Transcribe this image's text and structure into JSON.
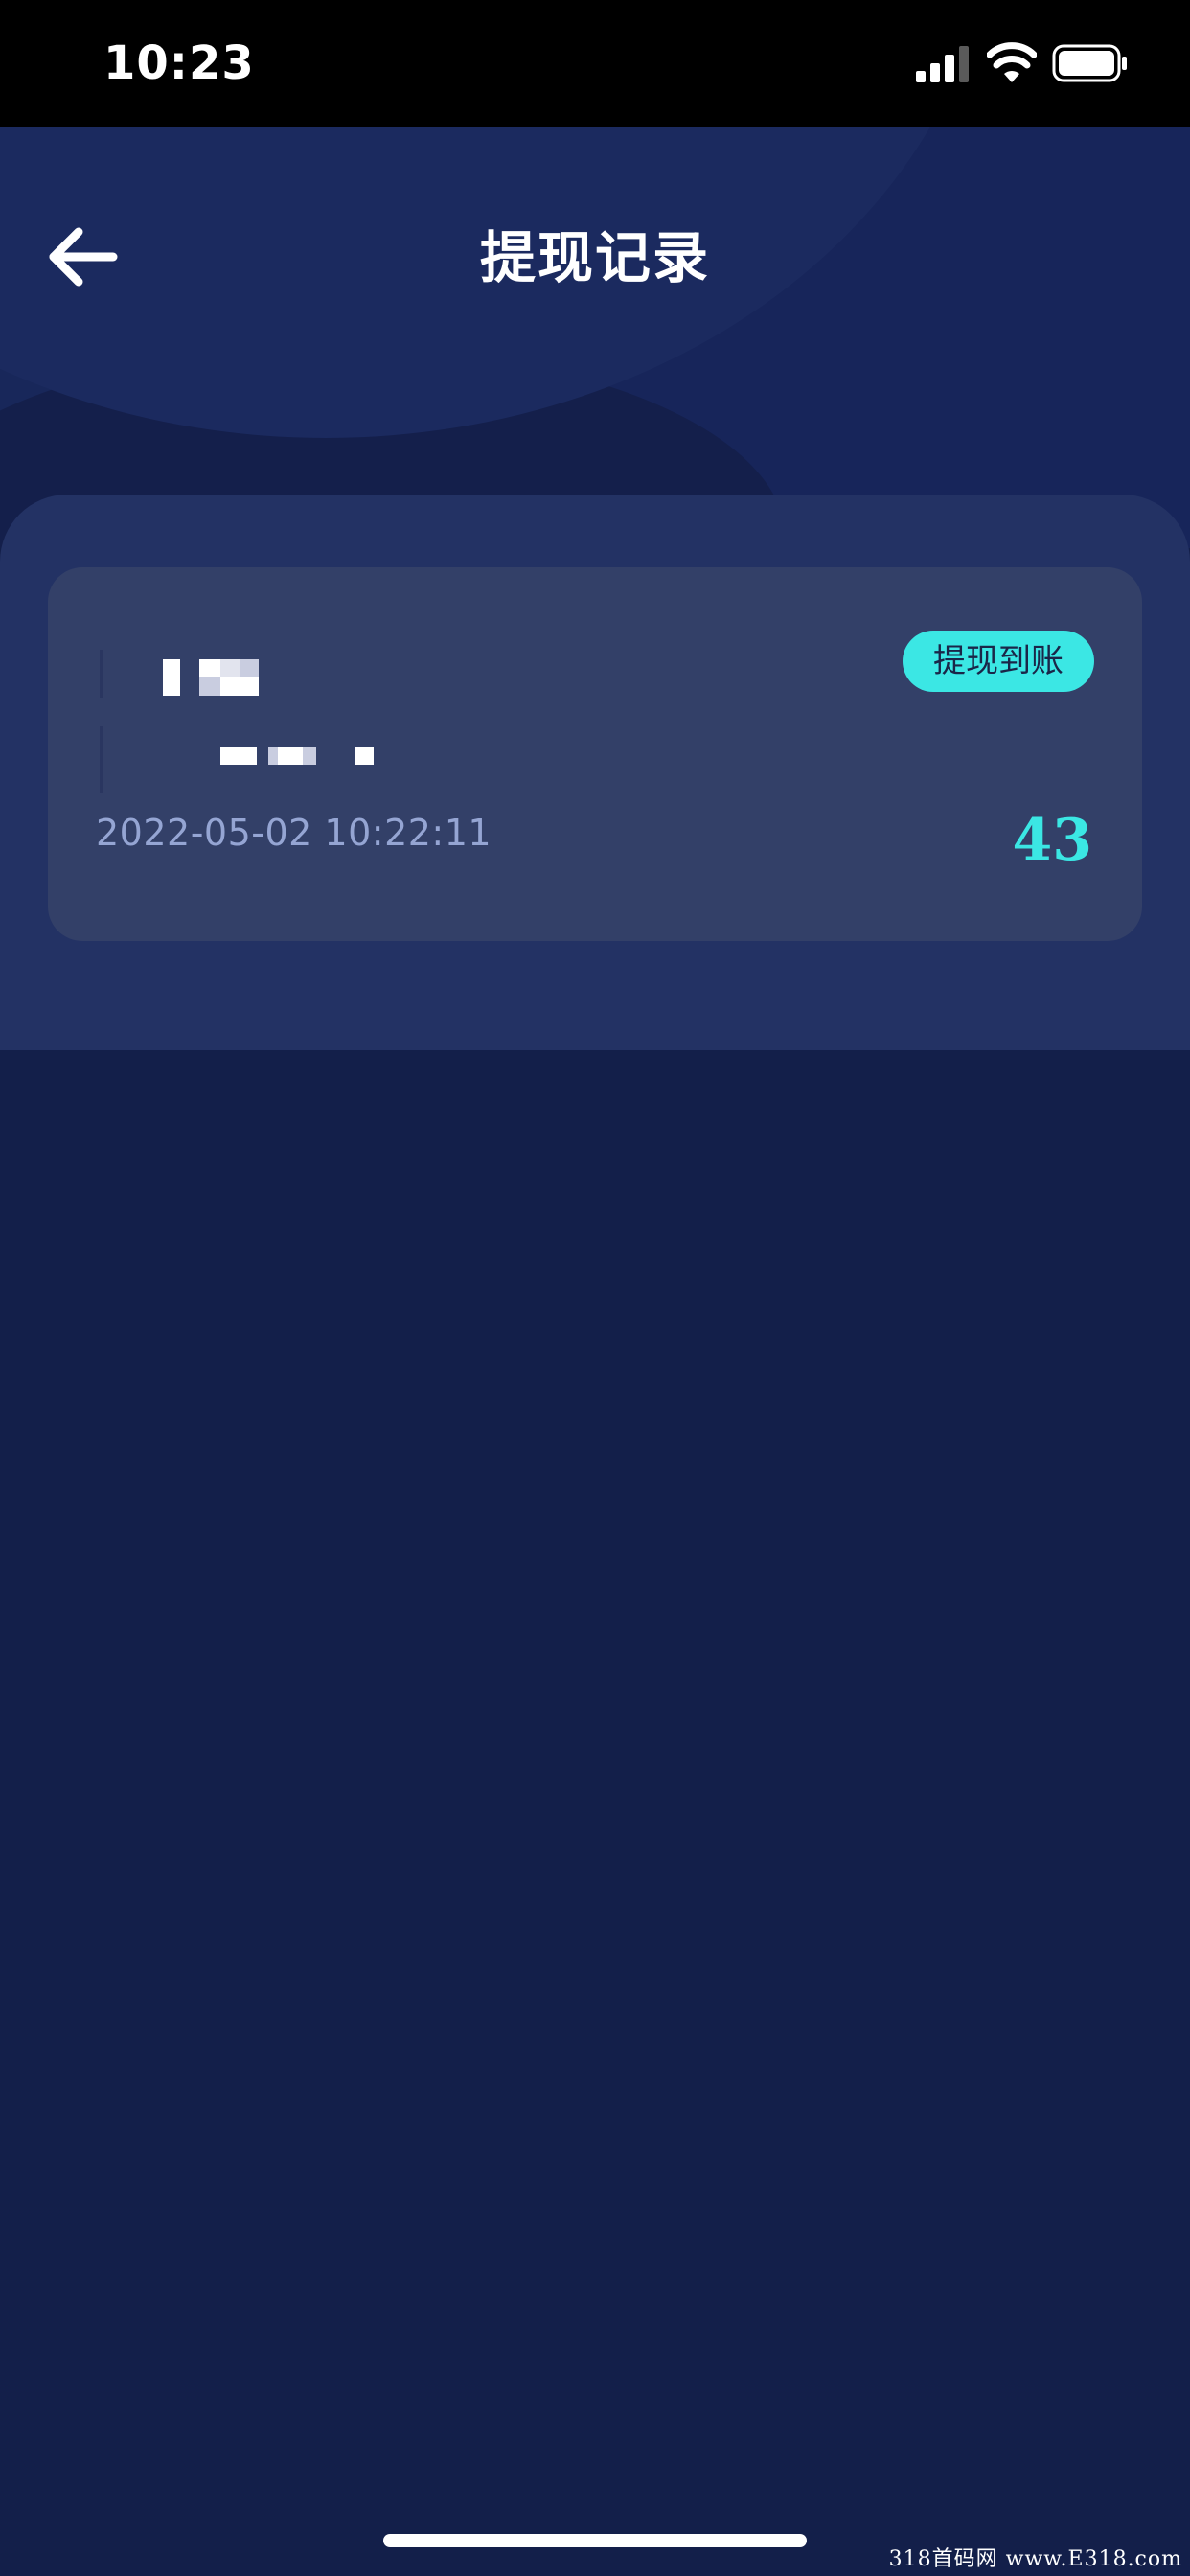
{
  "status_bar": {
    "time": "10:23",
    "icons": [
      "signal-icon",
      "wifi-icon",
      "battery-icon"
    ]
  },
  "header": {
    "title": "提现记录",
    "back_icon": "arrow-left-icon"
  },
  "records": [
    {
      "status": "提现到账",
      "time": "2022-05-02 10:22:11",
      "amount": "43"
    }
  ],
  "watermark": "318首码网 www.E318.com",
  "colors": {
    "background": "#131f4a",
    "panel": "#233264",
    "card": "#334068",
    "accent": "#3be7e4",
    "muted_text": "#95a5d3"
  }
}
